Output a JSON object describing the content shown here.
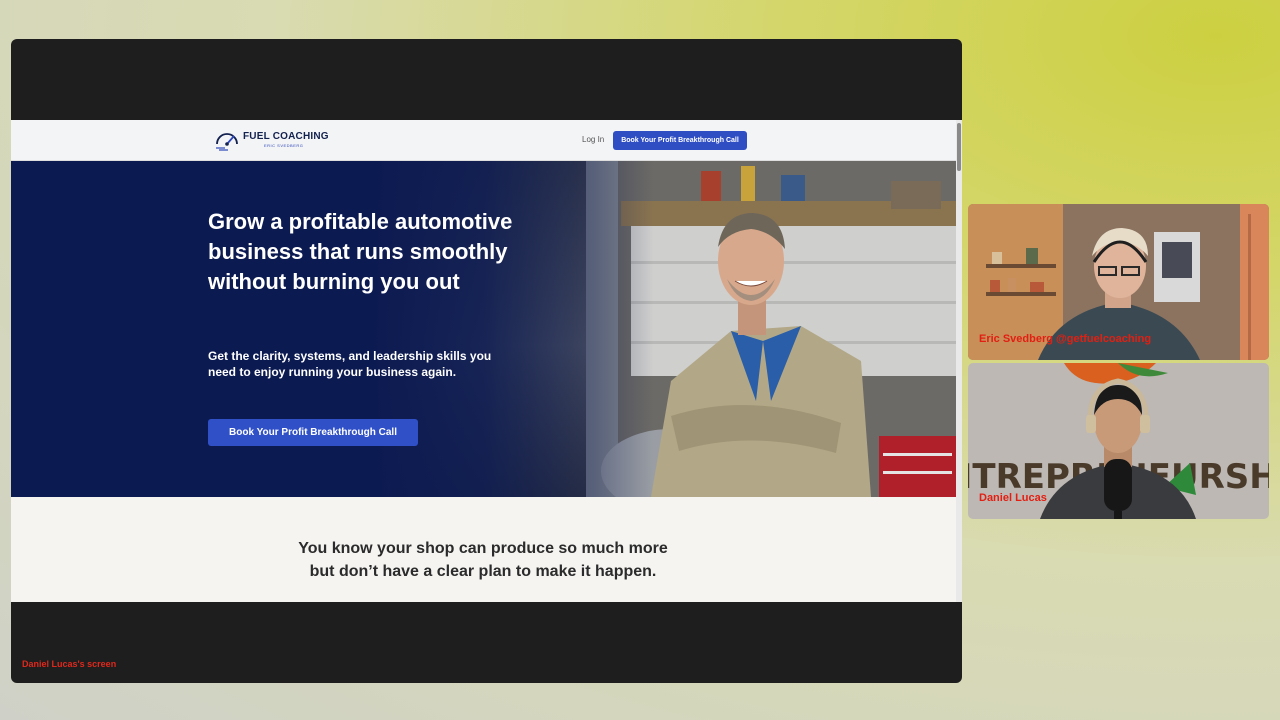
{
  "colors": {
    "nav_cta": "#2f4ec4",
    "hero_navy": "#0c1a52",
    "hero_cta": "#3050c8",
    "speaker_label": "#e21f12"
  },
  "website": {
    "logo": {
      "icon": "speedometer-icon",
      "title": "FUEL COACHING",
      "subtitle": "ERIC SVEDBERG"
    },
    "nav": {
      "login_label": "Log In",
      "cta_label": "Book Your Profit Breakthrough Call"
    },
    "hero": {
      "headline": "Grow a profitable automotive business that runs smoothly without burning you out",
      "subheadline": "Get the clarity, systems, and leadership skills you need to enjoy running your business again.",
      "cta_label": "Book Your Profit Breakthrough Call"
    },
    "problem": {
      "line1": "You know your shop can produce so much more",
      "line2": "but don’t have a clear plan to make it happen."
    }
  },
  "share": {
    "owner_label": "Daniel Lucas's screen"
  },
  "participants": [
    {
      "name": "Eric Svedberg @getfuelcoaching"
    },
    {
      "name": "Daniel Lucas",
      "backdrop_text": "ENTREPRENEURSHIP"
    }
  ]
}
